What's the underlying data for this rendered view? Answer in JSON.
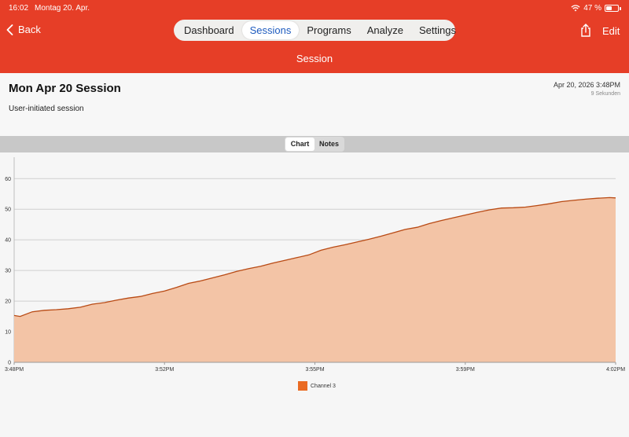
{
  "status_bar": {
    "time": "16:02",
    "date": "Montag 20. Apr.",
    "battery": "47 %"
  },
  "nav": {
    "back_label": "Back",
    "tabs": [
      {
        "label": "Dashboard",
        "active": false
      },
      {
        "label": "Sessions",
        "active": true
      },
      {
        "label": "Programs",
        "active": false
      },
      {
        "label": "Analyze",
        "active": false
      },
      {
        "label": "Settings",
        "active": false
      }
    ],
    "edit_label": "Edit",
    "title": "Session"
  },
  "session": {
    "title": "Mon Apr 20 Session",
    "description": "User-initiated session",
    "datetime": "Apr 20, 2026 3:48PM",
    "duration": "9 Sekunden"
  },
  "view_toggle": {
    "chart_label": "Chart",
    "notes_label": "Notes",
    "active": "chart"
  },
  "colors": {
    "accent": "#e63e27",
    "series_line": "#b84a14",
    "series_fill": "#f3c4a6",
    "legend": "#ea6b23",
    "selected_tab_text": "#1d5bbf"
  },
  "chart_data": {
    "type": "area",
    "x_ticks": [
      "3:48PM",
      "3:52PM",
      "3:55PM",
      "3:59PM",
      "4:02PM"
    ],
    "y_ticks": [
      0,
      10,
      20,
      30,
      40,
      50,
      60
    ],
    "ylim": [
      0,
      67
    ],
    "grid": true,
    "legend_position": "bottom",
    "series": [
      {
        "name": "Channel 3",
        "x": [
          0,
          0.01,
          0.03,
          0.05,
          0.07,
          0.09,
          0.11,
          0.13,
          0.15,
          0.17,
          0.19,
          0.21,
          0.23,
          0.25,
          0.27,
          0.29,
          0.31,
          0.33,
          0.35,
          0.37,
          0.39,
          0.41,
          0.43,
          0.45,
          0.47,
          0.49,
          0.51,
          0.53,
          0.55,
          0.57,
          0.59,
          0.61,
          0.63,
          0.65,
          0.67,
          0.69,
          0.71,
          0.73,
          0.75,
          0.77,
          0.79,
          0.81,
          0.83,
          0.85,
          0.87,
          0.89,
          0.91,
          0.93,
          0.95,
          0.97,
          0.99,
          1.0
        ],
        "values": [
          15.3,
          15.0,
          16.5,
          17.0,
          17.2,
          17.5,
          18.0,
          19.0,
          19.5,
          20.3,
          21.0,
          21.5,
          22.5,
          23.3,
          24.5,
          25.8,
          26.6,
          27.6,
          28.6,
          29.7,
          30.6,
          31.4,
          32.4,
          33.3,
          34.2,
          35.1,
          36.6,
          37.6,
          38.4,
          39.3,
          40.2,
          41.2,
          42.3,
          43.4,
          44.1,
          45.3,
          46.3,
          47.2,
          48.1,
          49.0,
          49.8,
          50.4,
          50.5,
          50.7,
          51.2,
          51.8,
          52.5,
          52.9,
          53.3,
          53.6,
          53.8,
          53.7
        ]
      }
    ]
  }
}
